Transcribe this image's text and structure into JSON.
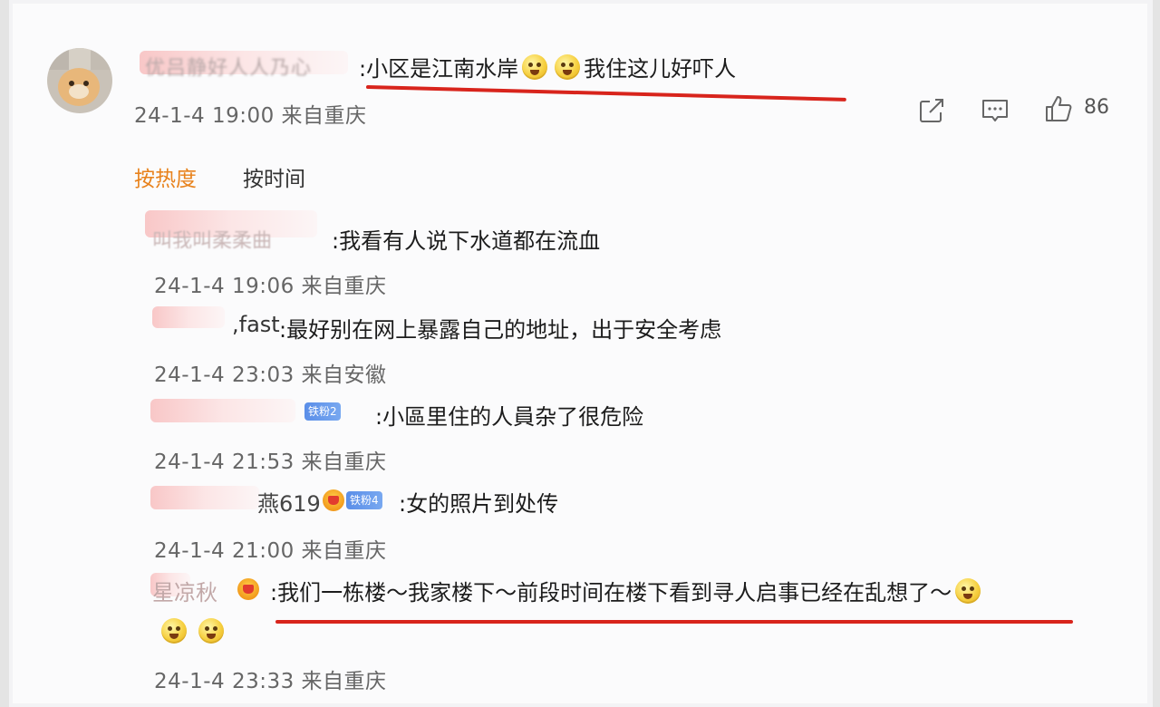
{
  "main_comment": {
    "name_hint": "优吕静好人人乃心",
    "text_before": ":小区是江南水岸",
    "emoji_name": "cry-emoji",
    "text_after": "我住这儿好吓人",
    "timestamp": "24-1-4 19:00",
    "location": "来自重庆",
    "like_count": "86"
  },
  "tabs": {
    "hot": "按热度",
    "time": "按时间"
  },
  "replies": [
    {
      "name_hint": "叫我叫柔柔曲",
      "text": ":我看有人说下水道都在流血",
      "timestamp": "24-1-4 19:06",
      "location": "来自重庆"
    },
    {
      "name_hint": "Iran, fast",
      "visible_name": ",fast",
      "text": ":最好别在网上暴露自己的地址，出于安全考虑",
      "timestamp": "24-1-4 23:03",
      "location": "来自安徽"
    },
    {
      "badge": "铁粉2",
      "text": ":小區里住的人員杂了很危险",
      "timestamp": "24-1-4 21:53",
      "location": "来自重庆"
    },
    {
      "visible_name": "燕619",
      "badge": "铁粉4",
      "text": ":女的照片到处传",
      "timestamp": "24-1-4 21:00",
      "location": "来自重庆"
    },
    {
      "visible_name": "星凉秋",
      "text": ":我们一栋楼～我家楼下～前段时间在楼下看到寻人启事已经在乱想了～",
      "timestamp": "24-1-4 23:33",
      "location": "来自重庆"
    }
  ],
  "colors": {
    "accent_orange": "#e8821c",
    "underline_red": "#d8241c",
    "badge_blue": "#5a8ee8"
  }
}
